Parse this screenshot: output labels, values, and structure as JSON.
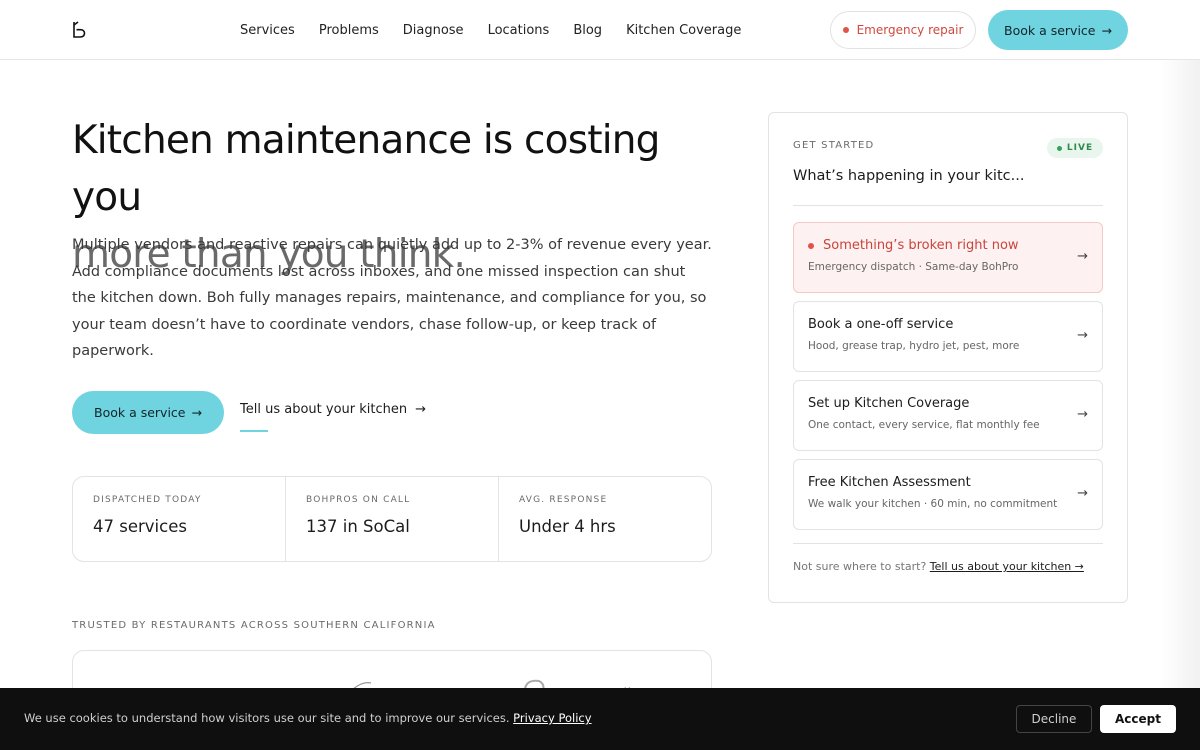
{
  "nav": {
    "logo_icon": "boh-logo-icon",
    "links": [
      "Services",
      "Problems",
      "Diagnose",
      "Locations",
      "Blog",
      "Kitchen Coverage"
    ],
    "emergency_label": "Emergency repair",
    "book_label": "Book a service",
    "arrow": "→"
  },
  "hero": {
    "title_line1": "Kitchen maintenance is costing you",
    "title_line2": "more than you think.",
    "description": "Multiple vendors and reactive repairs can quietly add up to 2-3% of revenue every year. Add compliance documents lost across inboxes, and one missed inspection can shut the kitchen down. Boh fully manages repairs, maintenance, and compliance for you, so your team doesn’t have to coordinate vendors, chase follow-up, or keep track of paperwork.",
    "primary_cta": "Book a service",
    "secondary_cta": "Tell us about your kitchen",
    "arrow": "→"
  },
  "stats": [
    {
      "label": "DISPATCHED TODAY",
      "value": "47 services"
    },
    {
      "label": "BOHPROS ON CALL",
      "value": "137 in SoCal"
    },
    {
      "label": "AVG. RESPONSE",
      "value": "Under 4 hrs"
    }
  ],
  "trusted_label": "TRUSTED BY RESTAURANTS ACROSS SOUTHERN CALIFORNIA",
  "card": {
    "kicker": "GET STARTED",
    "live_label": "LIVE",
    "title": "What’s happening in your kitc...",
    "options": [
      {
        "title": "Something’s broken right now",
        "subtitle": "Emergency dispatch · Same-day BohPro",
        "urgent": true
      },
      {
        "title": "Book a one-off service",
        "subtitle": "Hood, grease trap, hydro jet, pest, more"
      },
      {
        "title": "Set up Kitchen Coverage",
        "subtitle": "One contact, every service, flat monthly fee"
      },
      {
        "title": "Free Kitchen Assessment",
        "subtitle": "We walk your kitchen · 60 min, no commitment"
      }
    ],
    "arrow": "→",
    "footer_text": "Not sure where to start?",
    "footer_link": "Tell us about your kitchen →"
  },
  "cookie": {
    "text": "We use cookies to understand how visitors use our site and to improve our services.",
    "link": "Privacy Policy",
    "decline": "Decline",
    "accept": "Accept"
  },
  "colors": {
    "accent": "#6fd3e0",
    "emergency": "#d0483e",
    "live": "#2f8a4f"
  }
}
